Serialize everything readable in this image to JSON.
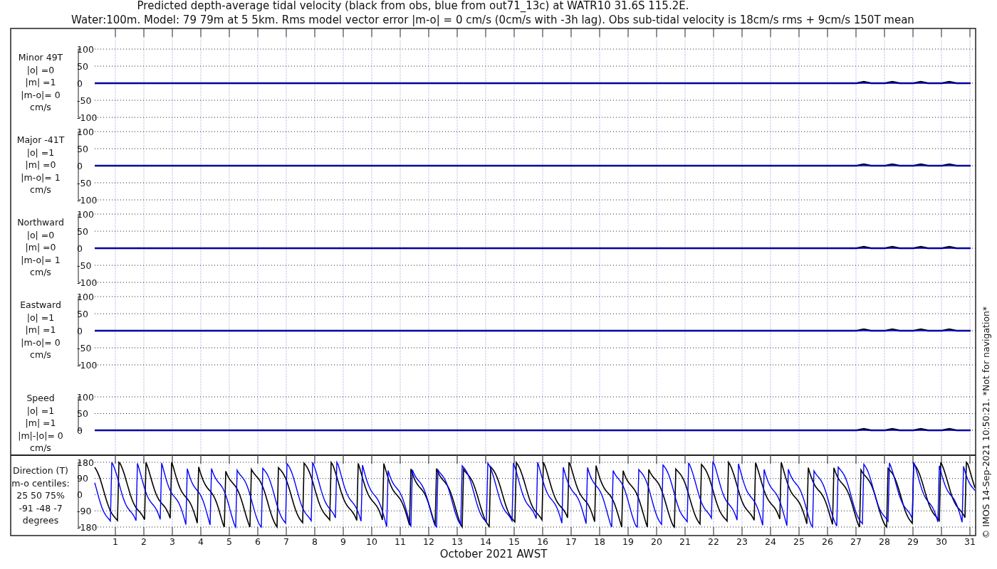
{
  "title_lines": [
    "Predicted depth-average tidal velocity (black from obs, blue from out71_13c) at WATR10 31.6S 115.2E.",
    "Water:100m. Model: 79 79m at 5 5km. Rms model vector error |m-o| = 0 cm/s (0cm/s with -3h lag). Obs sub-tidal velocity is 18cm/s rms + 9cm/s 150T mean"
  ],
  "panels": [
    {
      "kind": "velocity",
      "label_lines": [
        "Minor 49T",
        "|o| =0",
        "|m| =1",
        "|m-o|= 0",
        "cm/s"
      ],
      "yticks": [
        "100",
        "50",
        "0",
        "-50",
        "-100"
      ]
    },
    {
      "kind": "velocity",
      "label_lines": [
        "Major -41T",
        "|o| =1",
        "|m| =0",
        "|m-o|= 1",
        "cm/s"
      ],
      "yticks": [
        "100",
        "50",
        "0",
        "-50",
        "-100"
      ]
    },
    {
      "kind": "velocity",
      "label_lines": [
        "Northward",
        "|o| =0",
        "|m| =0",
        "|m-o|= 1",
        "cm/s"
      ],
      "yticks": [
        "100",
        "50",
        "0",
        "-50",
        "-100"
      ]
    },
    {
      "kind": "velocity",
      "label_lines": [
        "Eastward",
        "|o| =1",
        "|m| =1",
        "|m-o|= 0",
        "cm/s"
      ],
      "yticks": [
        "100",
        "50",
        "0",
        "-50",
        "-100"
      ]
    },
    {
      "kind": "speed",
      "label_lines": [
        "Speed",
        "|o| =1",
        "|m| =1",
        "|m|-|o|= 0",
        "cm/s"
      ],
      "yticks": [
        "100",
        "50",
        "0"
      ]
    },
    {
      "kind": "direction",
      "label_lines": [
        "Direction (T)",
        "m-o centiles:",
        "25  50  75%",
        "-91 -48  -7",
        "degrees"
      ],
      "yticks": [
        "180",
        "90",
        "0",
        "-90",
        "-180"
      ]
    }
  ],
  "xaxis": {
    "ticks": [
      "1",
      "2",
      "3",
      "4",
      "5",
      "6",
      "7",
      "8",
      "9",
      "10",
      "11",
      "12",
      "13",
      "14",
      "15",
      "16",
      "17",
      "18",
      "19",
      "20",
      "21",
      "22",
      "23",
      "24",
      "25",
      "26",
      "27",
      "28",
      "29",
      "30",
      "31"
    ],
    "label": "October 2021 AWST"
  },
  "credit": "© IMOS 14-Sep-2021 10:50:21. *Not for navigation*"
}
